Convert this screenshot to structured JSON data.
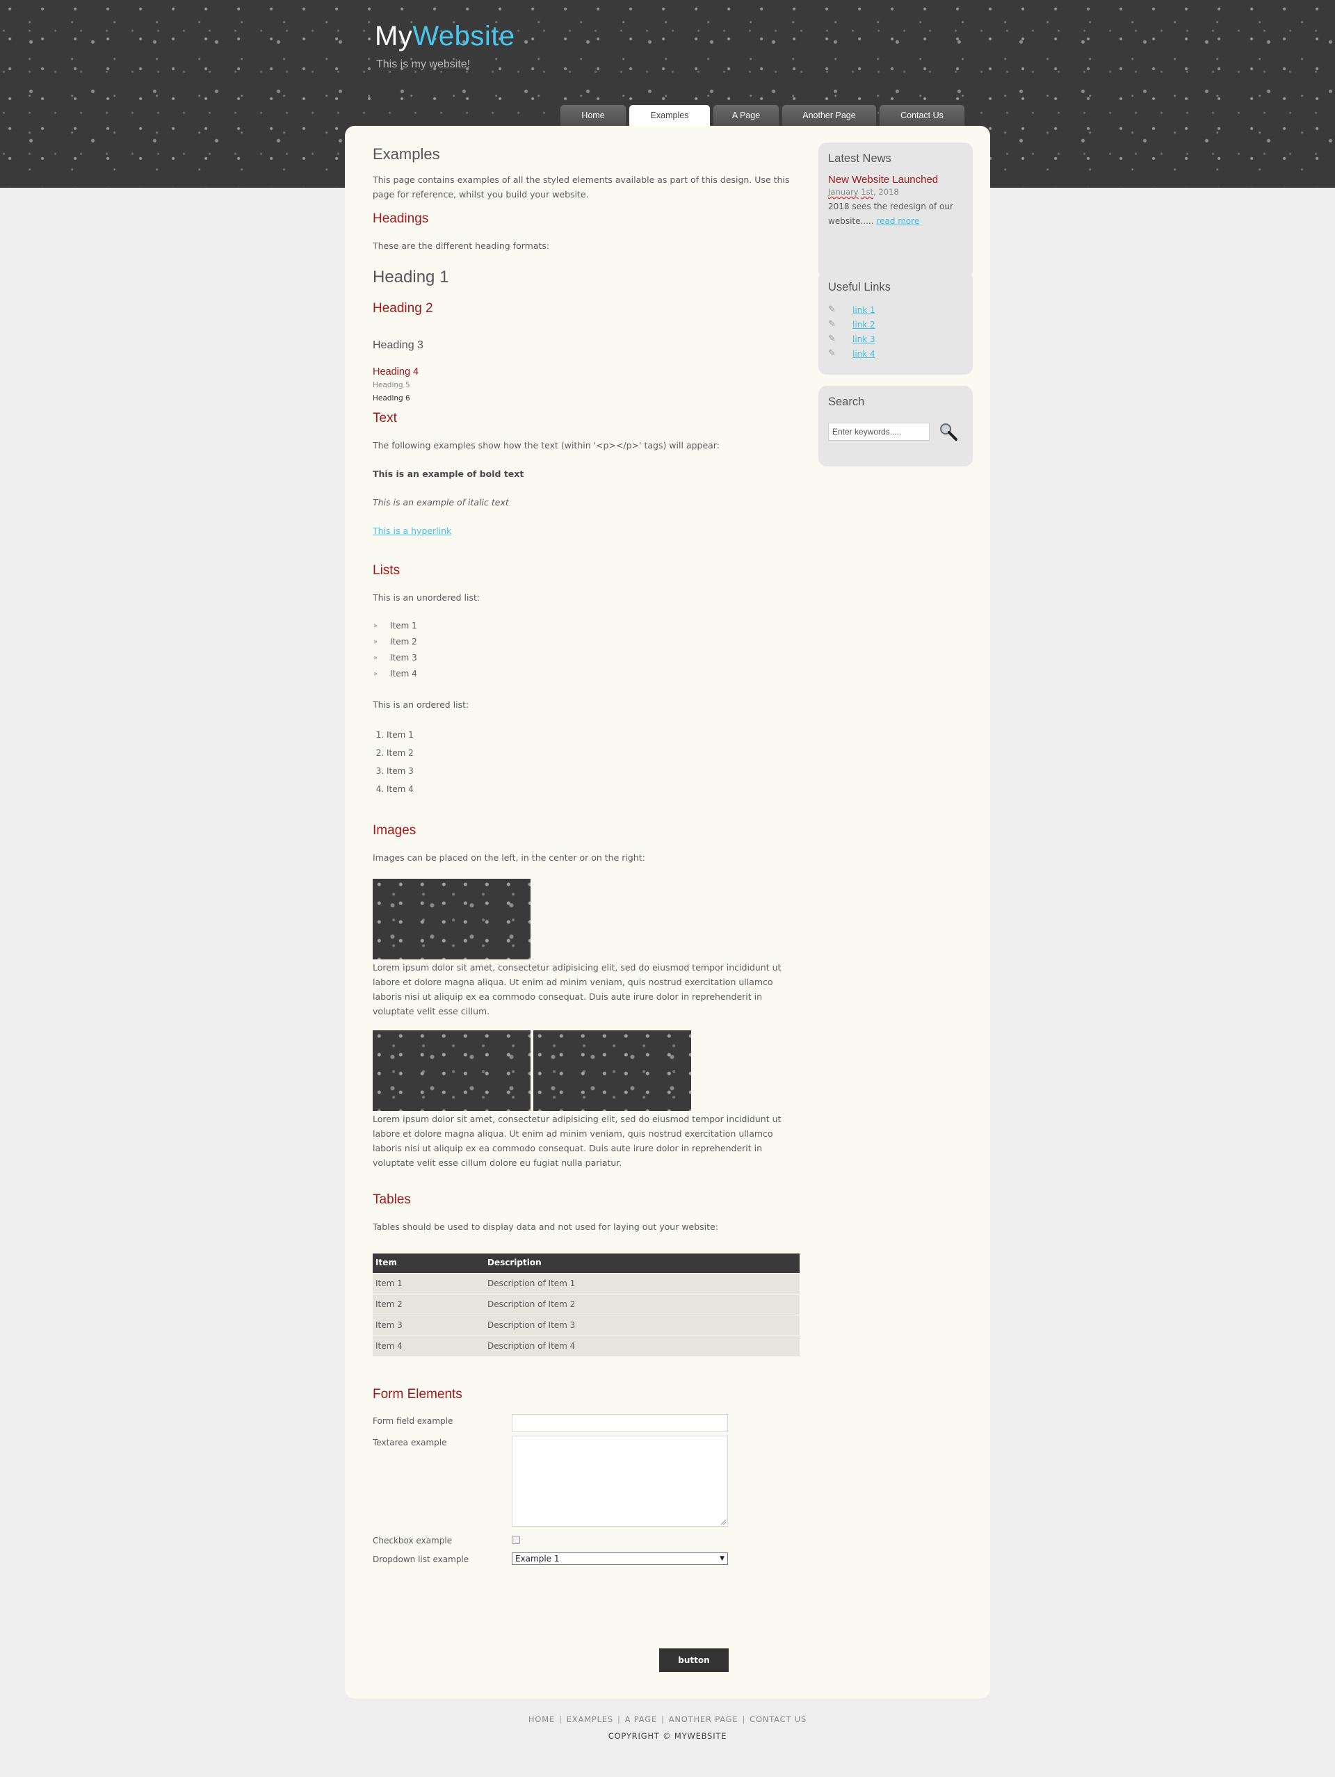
{
  "site": {
    "logo_part1": "My",
    "logo_part2": "Website",
    "slogan": "This is my website!"
  },
  "nav": {
    "items": [
      {
        "label": "Home"
      },
      {
        "label": "Examples"
      },
      {
        "label": "A Page"
      },
      {
        "label": "Another Page"
      },
      {
        "label": "Contact Us"
      }
    ],
    "active": "Examples"
  },
  "main": {
    "title": "Examples",
    "intro": "This page contains examples of all the styled elements available as part of this design. Use this page for reference, whilst you build your website.",
    "headings": {
      "title": "Headings",
      "desc": "These are the different heading formats:",
      "h1": "Heading 1",
      "h2": "Heading 2",
      "h3": "Heading 3",
      "h4": "Heading 4",
      "h5": "Heading 5",
      "h6": "Heading 6"
    },
    "text": {
      "title": "Text",
      "desc": "The following examples show how the text (within '<p></p>' tags) will appear:",
      "bold": "This is an example of bold text",
      "italic": "This is an example of italic text",
      "hyperlink": "This is a hyperlink"
    },
    "lists": {
      "title": "Lists",
      "unordered_desc": "This is an unordered list:",
      "unordered": [
        "Item 1",
        "Item 2",
        "Item 3",
        "Item 4"
      ],
      "ordered_desc": "This is an ordered list:",
      "ordered": [
        "Item 1",
        "Item 2",
        "Item 3",
        "Item 4"
      ]
    },
    "images": {
      "title": "Images",
      "desc": "Images can be placed on the left, in the center or on the right:",
      "lorem1": "Lorem ipsum dolor sit amet, consectetur adipisicing elit, sed do eiusmod tempor incididunt ut labore et dolore magna aliqua. Ut enim ad minim veniam, quis nostrud exercitation ullamco laboris nisi ut aliquip ex ea commodo consequat. Duis aute irure dolor in reprehenderit in voluptate velit esse cillum.",
      "lorem2": "Lorem ipsum dolor sit amet, consectetur adipisicing elit, sed do eiusmod tempor incididunt ut labore et dolore magna aliqua. Ut enim ad minim veniam, quis nostrud exercitation ullamco laboris nisi ut aliquip ex ea commodo consequat. Duis aute irure dolor in reprehenderit in voluptate velit esse cillum dolore eu fugiat nulla pariatur."
    },
    "tables": {
      "title": "Tables",
      "desc": "Tables should be used to display data and not used for laying out your website:",
      "headers": [
        "Item",
        "Description"
      ],
      "rows": [
        [
          "Item 1",
          "Description of Item 1"
        ],
        [
          "Item 2",
          "Description of Item 2"
        ],
        [
          "Item 3",
          "Description of Item 3"
        ],
        [
          "Item 4",
          "Description of Item 4"
        ]
      ]
    },
    "form": {
      "title": "Form Elements",
      "field_label": "Form field example",
      "field_value": "",
      "textarea_label": "Textarea example",
      "textarea_value": "",
      "checkbox_label": "Checkbox example",
      "checkbox_checked": false,
      "dropdown_label": "Dropdown list example",
      "dropdown_value": "Example 1",
      "button_label": "button"
    }
  },
  "sidebar": {
    "news": {
      "title": "Latest News",
      "headline": "New Website Launched",
      "date_month": "January",
      "date_day": "1st",
      "date_year": "2018",
      "body": "2018 sees the redesign of our website.....",
      "read_more": "read more"
    },
    "links": {
      "title": "Useful Links",
      "items": [
        "link 1",
        "link 2",
        "link 3",
        "link 4"
      ]
    },
    "search": {
      "title": "Search",
      "placeholder": "Enter keywords....."
    }
  },
  "footer": {
    "links": [
      "HOME",
      "EXAMPLES",
      "A PAGE",
      "ANOTHER PAGE",
      "CONTACT US"
    ],
    "separator": "|",
    "copyright": "COPYRIGHT © MYWEBSITE"
  }
}
